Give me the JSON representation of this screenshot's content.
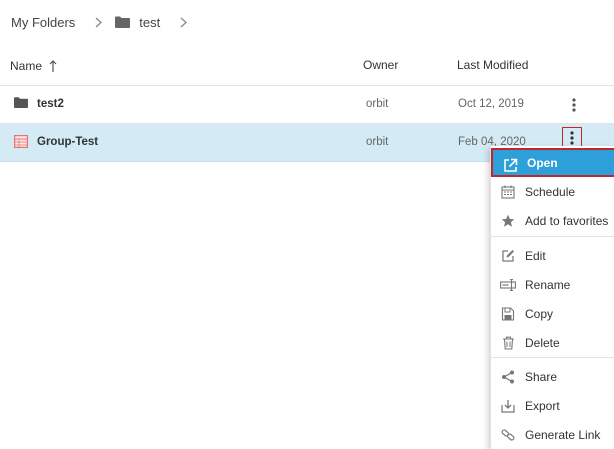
{
  "breadcrumb": {
    "root": "My Folders",
    "current": "test"
  },
  "table": {
    "headers": {
      "name": "Name",
      "owner": "Owner",
      "modified": "Last Modified"
    },
    "rows": [
      {
        "name": "test2",
        "owner": "orbit",
        "modified": "Oct 12, 2019",
        "type": "folder"
      },
      {
        "name": "Group-Test",
        "owner": "orbit",
        "modified": "Feb 04, 2020",
        "type": "report",
        "selected": true
      }
    ]
  },
  "context_menu": {
    "items": [
      {
        "label": "Open",
        "icon": "open-external-icon",
        "active": true
      },
      {
        "label": "Schedule",
        "icon": "calendar-icon"
      },
      {
        "label": "Add to favorites",
        "icon": "star-icon"
      },
      {
        "label": "Edit",
        "icon": "edit-icon"
      },
      {
        "label": "Rename",
        "icon": "rename-icon"
      },
      {
        "label": "Copy",
        "icon": "copy-icon"
      },
      {
        "label": "Delete",
        "icon": "trash-icon"
      },
      {
        "label": "Share",
        "icon": "share-icon"
      },
      {
        "label": "Export",
        "icon": "export-icon"
      },
      {
        "label": "Generate Link",
        "icon": "link-icon"
      }
    ]
  },
  "colors": {
    "selected_row": "#d4ebf5",
    "menu_active": "#2d9fd9",
    "highlight_border": "#c0272d",
    "folder_icon": "#555555",
    "report_icon": "#e57373"
  }
}
